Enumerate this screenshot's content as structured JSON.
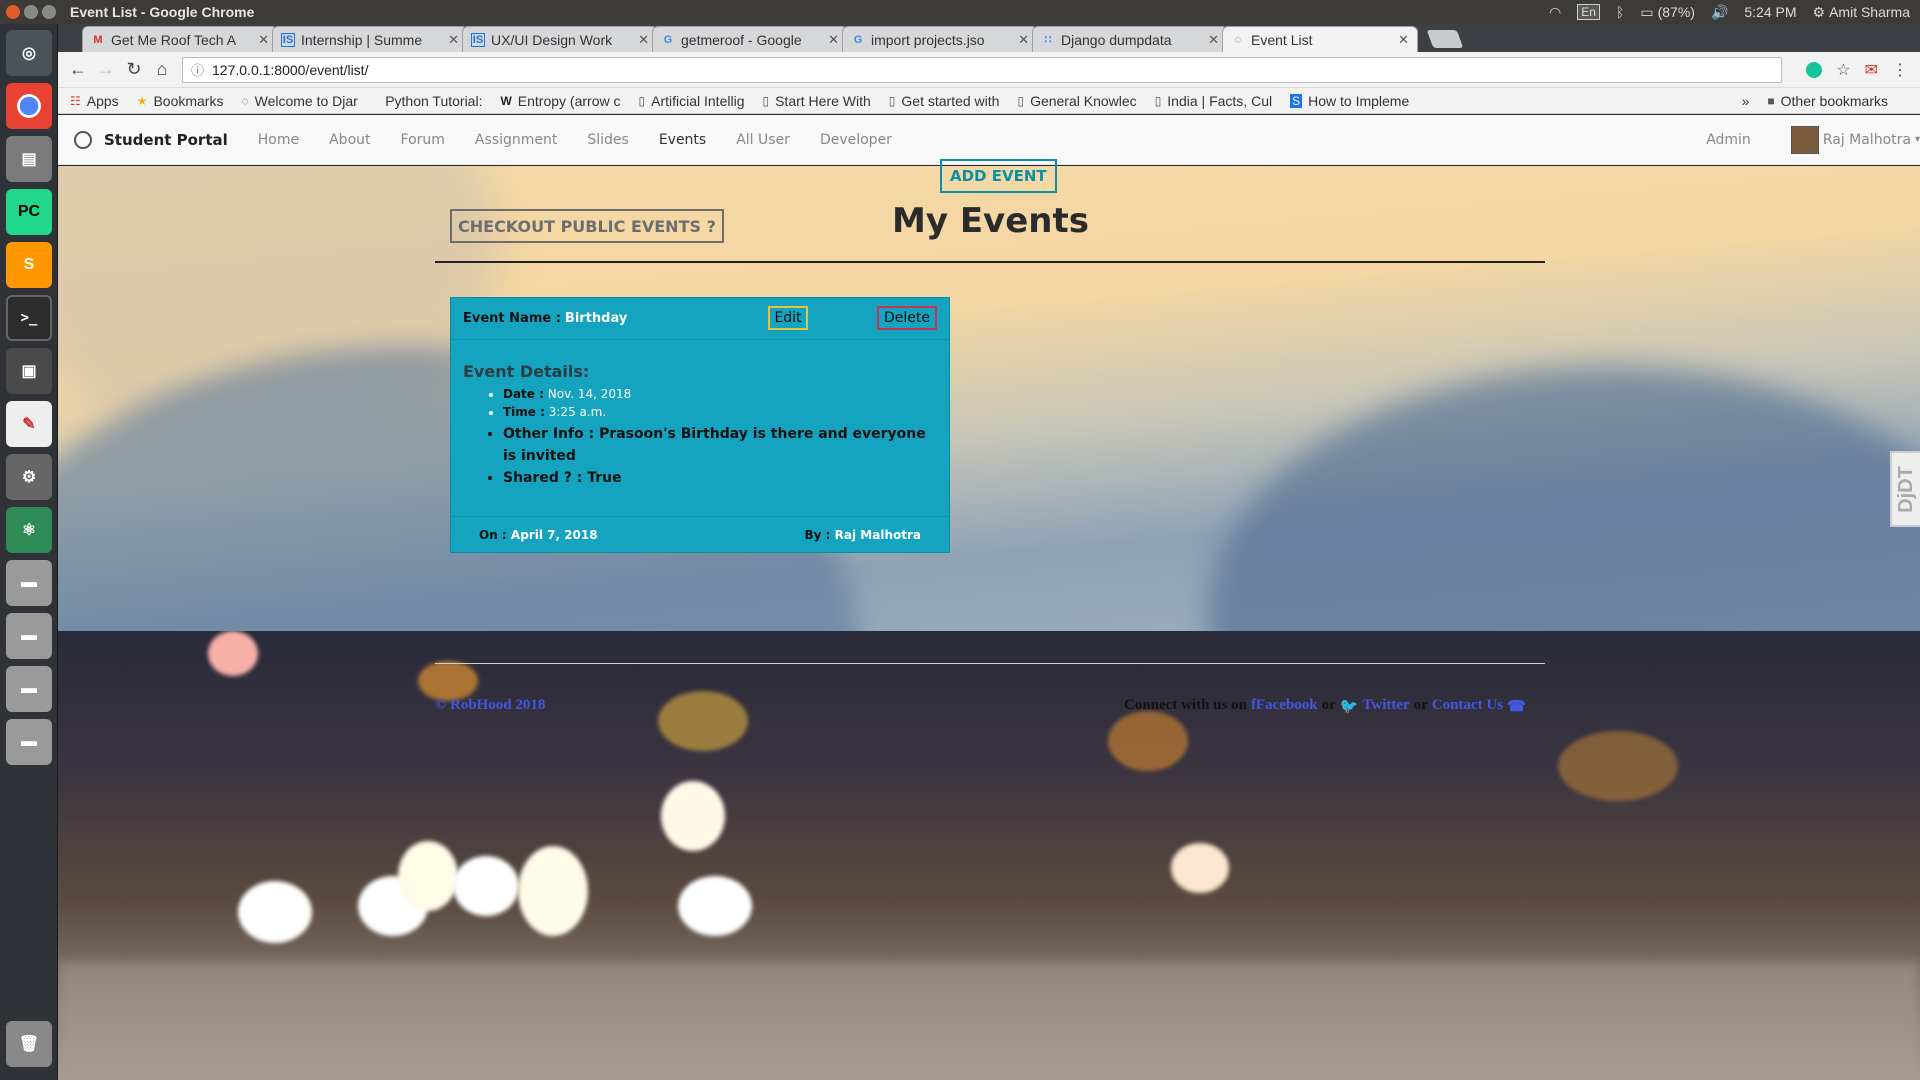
{
  "os": {
    "window_title": "Event List - Google Chrome",
    "keyboard": "En",
    "battery": "(87%)",
    "clock": "5:24 PM",
    "user": "Amit Sharma"
  },
  "browser": {
    "tabs": [
      {
        "label": "Get Me Roof Tech A",
        "icon": "gmail-icon"
      },
      {
        "label": "Internship | Summe",
        "icon": "internshala-icon"
      },
      {
        "label": "UX/UI Design Work",
        "icon": "internshala-icon"
      },
      {
        "label": "getmeroof - Google",
        "icon": "google-icon"
      },
      {
        "label": "import projects.jso",
        "icon": "google-icon"
      },
      {
        "label": "Django dumpdata",
        "icon": "confluence-icon"
      },
      {
        "label": "Event List",
        "icon": "globe-icon"
      }
    ],
    "url": "127.0.0.1:8000/event/list/",
    "bookmarks": [
      {
        "label": "Apps"
      },
      {
        "label": "Bookmarks"
      },
      {
        "label": "Welcome to Djar"
      },
      {
        "label": "Python Tutorial:"
      },
      {
        "label": "Entropy (arrow c"
      },
      {
        "label": "Artificial Intellig"
      },
      {
        "label": "Start Here With"
      },
      {
        "label": "Get started with"
      },
      {
        "label": "General Knowlec"
      },
      {
        "label": "India | Facts, Cul"
      },
      {
        "label": "How to Impleme"
      }
    ],
    "other_bookmarks": "Other bookmarks",
    "more": "»"
  },
  "navbar": {
    "brand": "Student Portal",
    "links": [
      "Home",
      "About",
      "Forum",
      "Assignment",
      "Slides",
      "Events",
      "All User",
      "Developer"
    ],
    "admin": "Admin",
    "user": "Raj Malhotra"
  },
  "main": {
    "add_event": "ADD EVENT",
    "checkout": "CHECKOUT PUBLIC EVENTS ?",
    "title": "My Events"
  },
  "event": {
    "name_label": "Event Name :",
    "name": "Birthday",
    "edit": "Edit",
    "delete": "Delete",
    "details_title": "Event Details:",
    "date_label": "Date :",
    "date": "Nov. 14, 2018",
    "time_label": "Time :",
    "time": "3:25 a.m.",
    "other_info": "Other Info : Prasoon's Birthday is there and everyone is invited",
    "shared": "Shared ? : True",
    "on_label": "On :",
    "on": "April 7, 2018",
    "by_label": "By :",
    "by": "Raj Malhotra"
  },
  "footer": {
    "copyright": "© RobHood 2018",
    "connect": "Connect with us on",
    "facebook": "fFacebook",
    "or1": "or",
    "twitter": "Twitter",
    "or2": "or",
    "contact": "Contact Us"
  },
  "debug_toolbar": "DjDT"
}
